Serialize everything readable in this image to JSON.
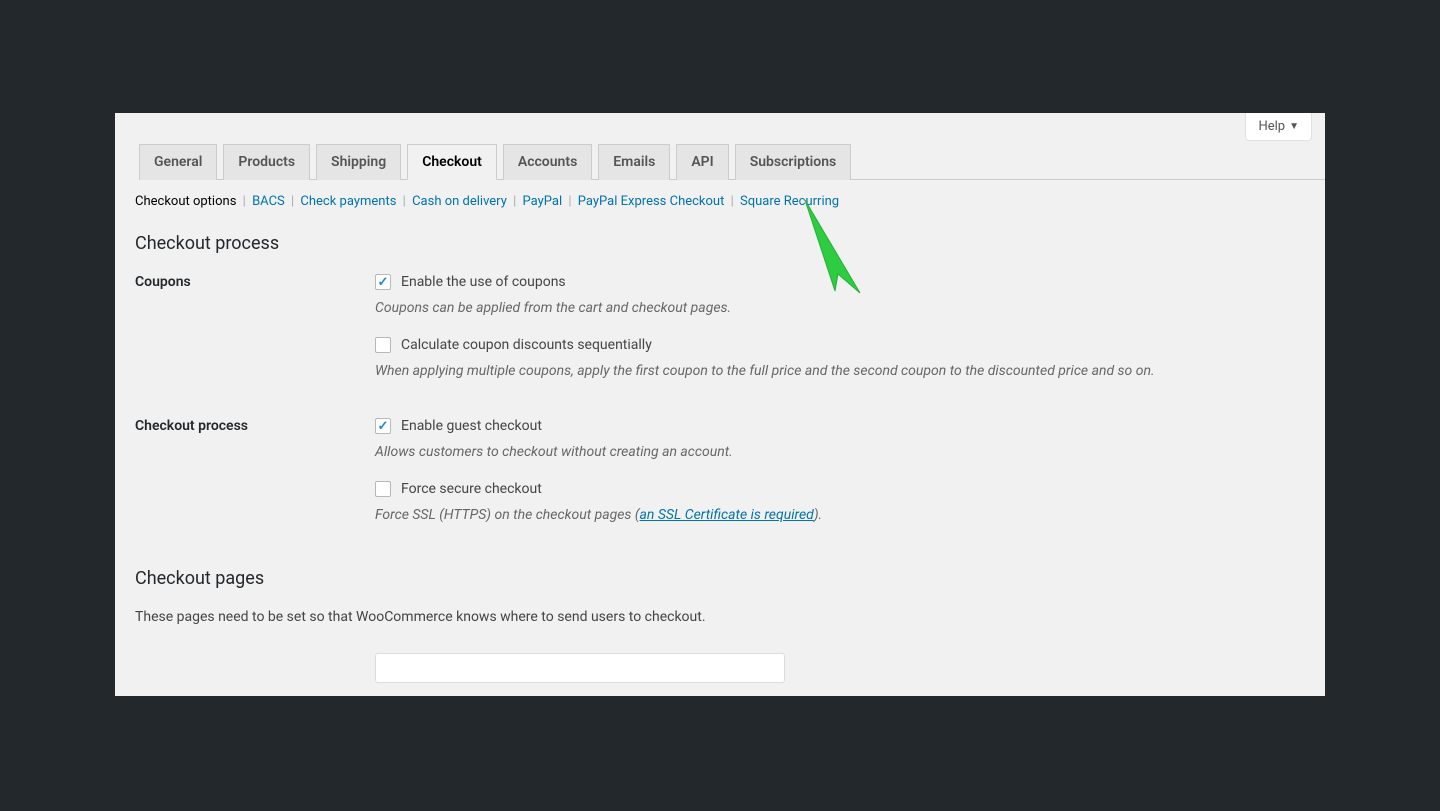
{
  "help_button": "Help",
  "tabs": [
    {
      "label": "General"
    },
    {
      "label": "Products"
    },
    {
      "label": "Shipping"
    },
    {
      "label": "Checkout",
      "active": true
    },
    {
      "label": "Accounts"
    },
    {
      "label": "Emails"
    },
    {
      "label": "API"
    },
    {
      "label": "Subscriptions"
    }
  ],
  "subnav": {
    "current": "Checkout options",
    "links": [
      "BACS",
      "Check payments",
      "Cash on delivery",
      "PayPal",
      "PayPal Express Checkout",
      "Square Recurring"
    ]
  },
  "section1_heading": "Checkout process",
  "coupons": {
    "label": "Coupons",
    "enable_label": "Enable the use of coupons",
    "enable_desc": "Coupons can be applied from the cart and checkout pages.",
    "seq_label": "Calculate coupon discounts sequentially",
    "seq_desc": "When applying multiple coupons, apply the first coupon to the full price and the second coupon to the discounted price and so on."
  },
  "checkout_process": {
    "label": "Checkout process",
    "guest_label": "Enable guest checkout",
    "guest_desc": "Allows customers to checkout without creating an account.",
    "secure_label": "Force secure checkout",
    "secure_desc_pre": "Force SSL (HTTPS) on the checkout pages (",
    "secure_link": "an SSL Certificate is required",
    "secure_desc_post": ")."
  },
  "section2_heading": "Checkout pages",
  "section2_intro": "These pages need to be set so that WooCommerce knows where to send users to checkout."
}
